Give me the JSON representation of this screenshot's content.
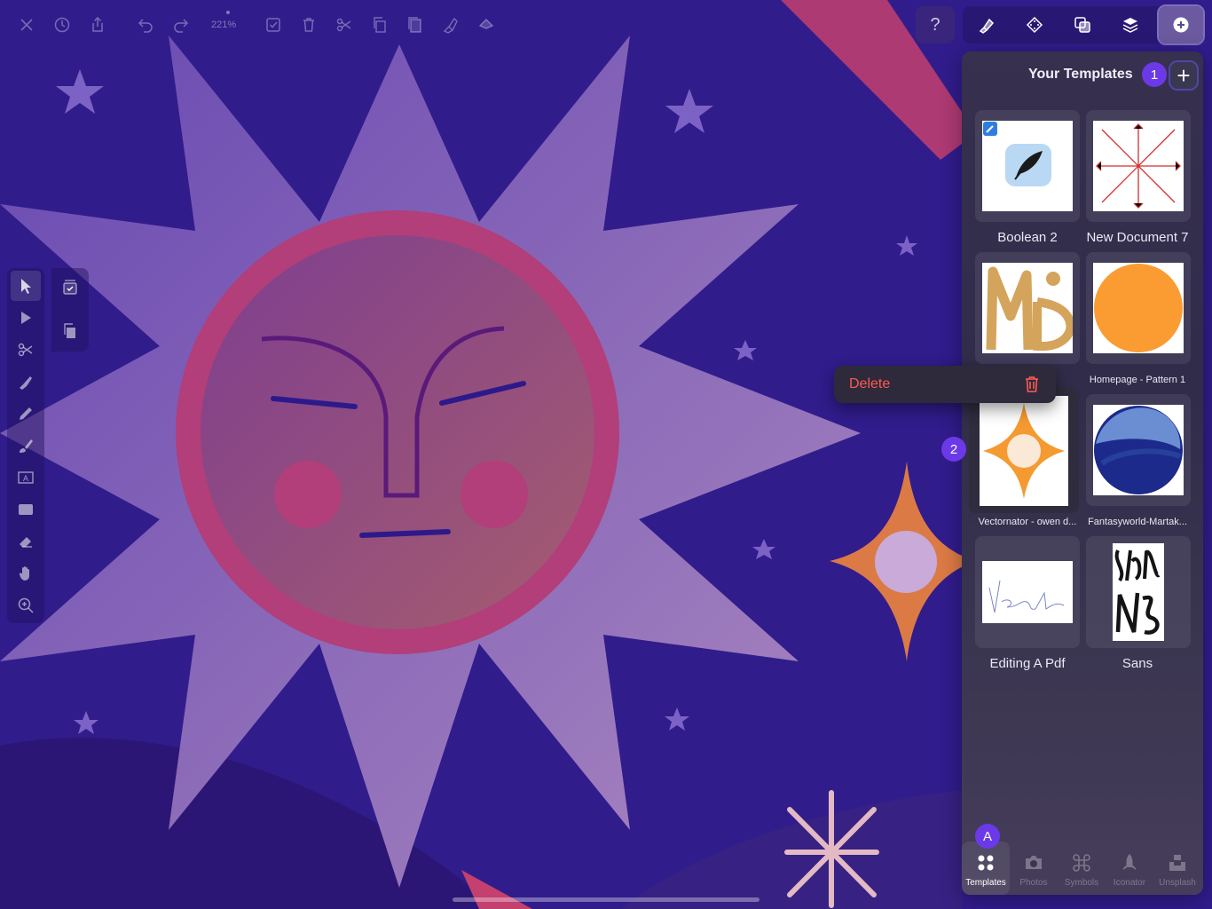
{
  "toolbar": {
    "zoom": "221%",
    "icons": [
      "close-icon",
      "history-icon",
      "share-icon",
      "undo-icon",
      "redo-icon",
      "select-all-icon",
      "trash-icon",
      "cut-icon",
      "copy-icon",
      "paste-icon",
      "pen-options-icon",
      "fill-icon"
    ]
  },
  "right_tools": {
    "help_label": "?",
    "icons": [
      "pen-settings-icon",
      "grid-icon",
      "boolean-icon",
      "layers-icon",
      "add-circle-icon"
    ]
  },
  "panel": {
    "title": "Your Templates",
    "add_label": "+",
    "count_badge": "1",
    "templates": [
      {
        "name": "Boolean 2"
      },
      {
        "name": "New Document 7"
      },
      {
        "name": ""
      },
      {
        "name": "Homepage - Pattern 1"
      },
      {
        "name": "Vectornator - owen d..."
      },
      {
        "name": "Fantasyworld-Martak..."
      },
      {
        "name": "Editing A Pdf"
      },
      {
        "name": "Sans"
      }
    ]
  },
  "context_menu": {
    "delete_label": "Delete",
    "badge": "2"
  },
  "tabs": [
    {
      "label": "Templates",
      "icon": "grid-dots-icon"
    },
    {
      "label": "Photos",
      "icon": "camera-icon"
    },
    {
      "label": "Symbols",
      "icon": "command-icon"
    },
    {
      "label": "Iconator",
      "icon": "rocket-icon"
    },
    {
      "label": "Unsplash",
      "icon": "unsplash-icon"
    }
  ],
  "user_initial": "A",
  "colors": {
    "accent": "#6b39e8",
    "danger": "#ff5a52",
    "canvas_bg": "#2f1a8a"
  }
}
